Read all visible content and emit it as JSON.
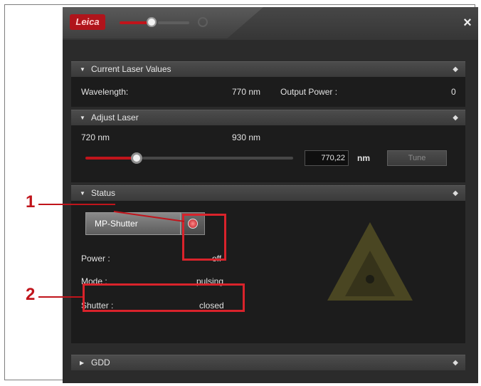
{
  "window": {
    "close_glyph": "×",
    "logo_text": "Leica"
  },
  "sections": {
    "current": {
      "title": "Current Laser Values",
      "wavelength_label": "Wavelength:",
      "wavelength_value": "770 nm",
      "output_power_label": "Output Power :",
      "output_power_value": "0"
    },
    "adjust": {
      "title": "Adjust Laser",
      "min_label": "720 nm",
      "max_label": "930 nm",
      "slider_fraction": 0.24,
      "wavelength_input": "770,22",
      "unit": "nm",
      "tune_label": "Tune"
    },
    "status": {
      "title": "Status",
      "shutter_button": "MP-Shutter",
      "power_label": "Power :",
      "power_value": "off",
      "mode_label": "Mode :",
      "mode_value": "pulsing",
      "shutter_label": "Shutter :",
      "shutter_value": "closed"
    },
    "gdd": {
      "title": "GDD"
    }
  },
  "callouts": [
    "1",
    "2"
  ],
  "icons": {
    "section_expanded": "▼",
    "section_collapsed": "▶",
    "pin": "pin-icon",
    "laser_warning": "laser-warning-icon"
  },
  "colors": {
    "accent": "#c0141b",
    "callout": "#d9232b",
    "panel": "#2b2b2b"
  }
}
